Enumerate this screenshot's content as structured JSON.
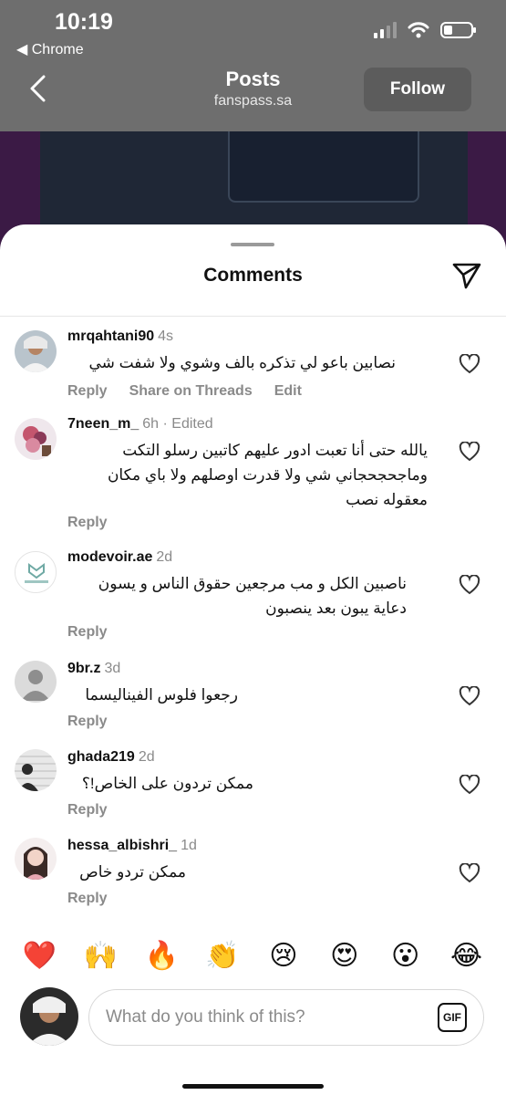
{
  "status": {
    "time": "10:19",
    "back_app": "◀ Chrome"
  },
  "nav": {
    "title": "Posts",
    "subtitle": "fanspass.sa",
    "follow_label": "Follow"
  },
  "sheet": {
    "title": "Comments"
  },
  "comments": [
    {
      "user": "mrqahtani90",
      "meta": "4s",
      "text": "نصابين باعو لي تذكره بالف وشوي ولا شفت شي",
      "actions": [
        "Reply",
        "Share on Threads",
        "Edit"
      ]
    },
    {
      "user": "7neen_m_",
      "meta": "6h · Edited",
      "text": "يالله حتى أنا تعبت ادور عليهم كاتبين رسلو التكت وماجحجحجاني شي ولا قدرت اوصلهم ولا باي مكان معقوله نصب",
      "actions": [
        "Reply"
      ]
    },
    {
      "user": "modevoir.ae",
      "meta": "2d",
      "text": "ناصبين الكل و مب مرجعين حقوق الناس و يسون دعاية يبون بعد ينصبون",
      "actions": [
        "Reply"
      ]
    },
    {
      "user": "9br.z",
      "meta": "3d",
      "text": "رجعوا فلوس الفيناليسما",
      "actions": [
        "Reply"
      ]
    },
    {
      "user": "ghada219",
      "meta": "2d",
      "text": "ممكن تردون على الخاص!؟",
      "actions": [
        "Reply"
      ]
    },
    {
      "user": "hessa_albishri_",
      "meta": "1d",
      "text": "ممكن تردو خاص",
      "actions": [
        "Reply"
      ]
    }
  ],
  "emoji_bar": [
    "❤️",
    "🙌",
    "🔥",
    "👏",
    "😢",
    "😍",
    "😮",
    "😂"
  ],
  "composer": {
    "placeholder": "What do you think of this?",
    "gif_label": "GIF"
  },
  "colors": {
    "accent_purple": "#3b1a45",
    "meta_gray": "#8a8a8a"
  }
}
